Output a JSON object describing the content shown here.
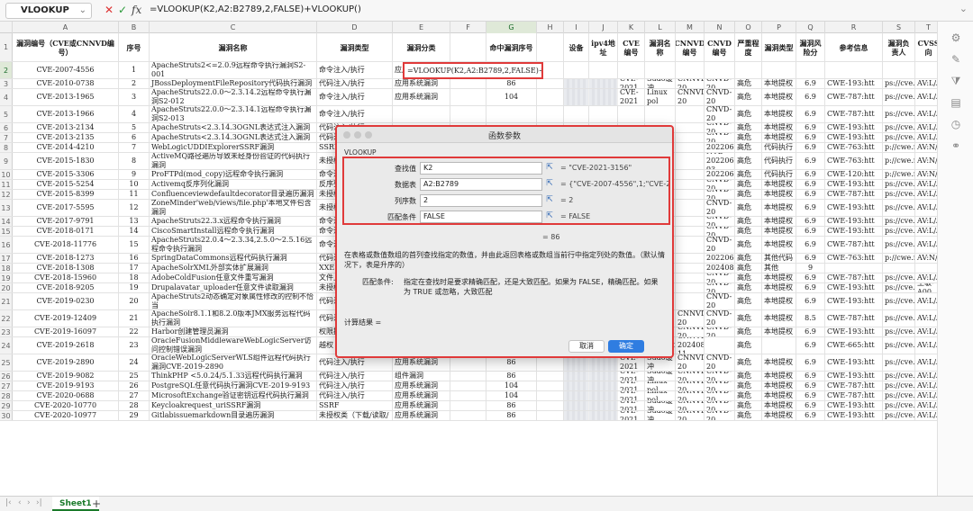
{
  "formula_bar": {
    "name_box": "VLOOKUP",
    "formula": "=VLOOKUP(K2,A2:B2789,2,FALSE)+VLOOKUP()"
  },
  "columns": [
    "A",
    "B",
    "C",
    "D",
    "E",
    "F",
    "G",
    "H",
    "I",
    "J",
    "K",
    "L",
    "M",
    "N",
    "O",
    "P",
    "Q",
    "R",
    "S",
    "T"
  ],
  "header_row": {
    "A": "漏洞编号（CVE或CNNVD编号）",
    "B": "序号",
    "C": "漏洞名称",
    "D": "漏洞类型",
    "E": "漏洞分类",
    "G": "命中漏洞序号",
    "I": "设备",
    "J": "ipv4地址",
    "K": "CVE编号",
    "L": "漏洞名称",
    "M": "CNNVD编号",
    "N": "CNVD编号",
    "O": "严重程度",
    "P": "漏洞类型",
    "Q": "漏洞风险分",
    "R": "参考信息",
    "S": "漏洞负责人",
    "T": "CVSS向"
  },
  "selected_cell": {
    "text": "=VLOOKUP(K2,A2:B2789,2,FALSE)+VLOOKUP("
  },
  "rows": [
    {
      "n": "2",
      "a": "CVE-2007-4556",
      "b": "1",
      "c": "ApacheStruts2<=2.0.9远程命令执行漏洞S2-001",
      "d": "命令注入/执行",
      "e": "应用系",
      "k": "",
      "l": "",
      "m": "",
      "n_": "",
      "o": "",
      "p": "",
      "q": "",
      "r": "",
      "s": "",
      "t": ""
    },
    {
      "n": "3",
      "a": "CVE-2010-0738",
      "b": "2",
      "c": "JBossDeploymentFileRepository代码执行漏洞",
      "d": "代码注入/执行",
      "e": "应用系统漏洞",
      "g": "86",
      "k": "CVE-2021",
      "l": "Sudo缓冲",
      "m": "CNNVD-20",
      "n_": "CNVD-20",
      "o": "高危",
      "p": "本地提权",
      "q": "6.9",
      "r": "CWE-193:htt",
      "s": "ps://cve.mitre.or",
      "t": "AV:L/A"
    },
    {
      "n": "4",
      "a": "CVE-2013-1965",
      "b": "3",
      "c": "ApacheStruts22.0.0～2.3.14.2远程命令执行漏洞S2-012",
      "d": "命令注入/执行",
      "e": "应用系统漏洞",
      "g": "104",
      "k": "CVE-2021",
      "l": "Linux pol",
      "m": "CNNVD-20",
      "n_": "CNVD-20",
      "o": "高危",
      "p": "本地提权",
      "q": "6.9",
      "r": "CWE-787:htt",
      "s": "ps://cve.mitre.or",
      "t": "AV:L/A"
    },
    {
      "n": "5",
      "a": "CVE-2013-1966",
      "b": "4",
      "c": "ApacheStruts22.0.0～2.3.14.1远程命令执行漏洞S2-013",
      "d": "命令注入/执行",
      "e": "",
      "g": "",
      "k": "",
      "l": "",
      "m": "",
      "n_": "CNVD-20",
      "o": "高危",
      "p": "本地提权",
      "q": "6.9",
      "r": "CWE-787:htt",
      "s": "ps://cve.mitre.or",
      "t": "AV:L/A"
    },
    {
      "n": "6",
      "a": "CVE-2013-2134",
      "b": "5",
      "c": "ApacheStruts<2.3.14.3OGNL表达式注入漏洞",
      "d": "代码注入/执行",
      "e": "",
      "g": "",
      "k": "",
      "l": "",
      "m": "",
      "n_": "CNVD-20",
      "o": "高危",
      "p": "本地提权",
      "q": "6.9",
      "r": "CWE-193:htt",
      "s": "ps://cve.mitre.or",
      "t": "AV:L/A"
    },
    {
      "n": "7",
      "a": "CVE-2013-2135",
      "b": "6",
      "c": "ApacheStruts<2.3.14.3OGNL表达式注入漏洞",
      "d": "代码注入/执行",
      "e": "",
      "g": "",
      "k": "",
      "l": "",
      "m": "",
      "n_": "CNVD-20",
      "o": "高危",
      "p": "本地提权",
      "q": "6.9",
      "r": "CWE-193:htt",
      "s": "ps://cve.mitre.or",
      "t": "AV:L/A"
    },
    {
      "n": "8",
      "a": "CVE-2014-4210",
      "b": "7",
      "c": "WebLogicUDDIExplorerSSRF漏洞",
      "d": "SSRF",
      "e": "",
      "g": "",
      "k": "",
      "l": "",
      "m": "",
      "n_": "NVD-202206-93",
      "o": "高危",
      "p": "代码执行",
      "q": "6.9",
      "r": "CWE-763:htt",
      "s": "p://cwe.mitre.org",
      "t": "AV:N/A"
    },
    {
      "n": "9",
      "a": "CVE-2015-1830",
      "b": "8",
      "c": "ActiveMQ路径遍历导致未经身份验证的代码执行漏洞",
      "d": "未授权类（",
      "e": "",
      "g": "",
      "k": "",
      "l": "",
      "m": "",
      "n_": "NVD-202206-93",
      "o": "高危",
      "p": "代码执行",
      "q": "6.9",
      "r": "CWE-763:htt",
      "s": "p://cwe.mitre.org",
      "t": "AV:N/A"
    },
    {
      "n": "10",
      "a": "CVE-2015-3306",
      "b": "9",
      "c": "ProFTPd(mod_copy)远程命令执行漏洞",
      "d": "命令注入/执行",
      "e": "",
      "g": "",
      "k": "",
      "l": "",
      "m": "",
      "n_": "NVD-202206-92",
      "o": "高危",
      "p": "代码执行",
      "q": "6.9",
      "r": "CWE-120:htt",
      "s": "p://cwe.mitre.org",
      "t": "AV:N/A"
    },
    {
      "n": "11",
      "a": "CVE-2015-5254",
      "b": "10",
      "c": "Activemq反序列化漏洞",
      "d": "反序列化",
      "e": "",
      "g": "",
      "k": "",
      "l": "",
      "m": "",
      "n_": "CNVD-20",
      "o": "高危",
      "p": "本地提权",
      "q": "6.9",
      "r": "CWE-193:htt",
      "s": "ps://cve.mitre.or",
      "t": "AV:L/A"
    },
    {
      "n": "12",
      "a": "CVE-2015-8399",
      "b": "11",
      "c": "Confluenceviewdefaultdecorator目录遍历漏洞",
      "d": "未授权类（",
      "e": "",
      "g": "",
      "k": "",
      "l": "",
      "m": "",
      "n_": "CNVD-20",
      "o": "高危",
      "p": "本地提权",
      "q": "6.9",
      "r": "CWE-787:htt",
      "s": "ps://cve.mitre.or",
      "t": "AV:L/A"
    },
    {
      "n": "13",
      "a": "CVE-2017-5595",
      "b": "12",
      "c": "ZoneMinder'web/views/file.php'本地文件包含漏洞",
      "d": "未授权类（",
      "e": "",
      "g": "86",
      "k": "",
      "l": "",
      "m": "",
      "n_": "CNVD-20",
      "o": "高危",
      "p": "本地提权",
      "q": "6.9",
      "r": "CWE-193:htt",
      "s": "ps://cve.mitre.or",
      "t": "AV:L/A"
    },
    {
      "n": "14",
      "a": "CVE-2017-9791",
      "b": "13",
      "c": "ApacheStruts22.3.x远程命令执行漏洞",
      "d": "命令注入/执行",
      "e": "",
      "g": "",
      "k": "",
      "l": "",
      "m": "",
      "n_": "CNVD-20",
      "o": "高危",
      "p": "本地提权",
      "q": "6.9",
      "r": "CWE-193:htt",
      "s": "ps://cve.mitre.or",
      "t": "AV:L/A"
    },
    {
      "n": "15",
      "a": "CVE-2018-0171",
      "b": "14",
      "c": "CiscoSmartInstall远程命令执行漏洞",
      "d": "命令注入/执行",
      "e": "",
      "g": "",
      "k": "",
      "l": "",
      "m": "",
      "n_": "CNVD-20",
      "o": "高危",
      "p": "本地提权",
      "q": "6.9",
      "r": "CWE-193:htt",
      "s": "ps://cve.mitre.or",
      "t": "AV:L/A"
    },
    {
      "n": "16",
      "a": "CVE-2018-11776",
      "b": "15",
      "c": "ApacheStruts22.0.4～2.3.34,2.5.0～2.5.16远程命令执行漏洞",
      "d": "命令注入/执行",
      "e": "",
      "g": "",
      "k": "",
      "l": "",
      "m": "",
      "n_": "CNVD-20",
      "o": "高危",
      "p": "本地提权",
      "q": "6.9",
      "r": "CWE-787:htt",
      "s": "ps://cve.mitre.or",
      "t": "AV:L/A"
    },
    {
      "n": "17",
      "a": "CVE-2018-1273",
      "b": "16",
      "c": "SpringDataCommons远程代码执行漏洞",
      "d": "代码注入/执行",
      "e": "",
      "g": "",
      "k": "",
      "l": "",
      "m": "",
      "n_": "NVD-202206-93",
      "o": "高危",
      "p": "其他代码",
      "q": "6.9",
      "r": "CWE-763:htt",
      "s": "p://cwe.mitre.org",
      "t": "AV:N/A"
    },
    {
      "n": "18",
      "a": "CVE-2018-1308",
      "b": "17",
      "c": "ApacheSolrXML外部实体扩展漏洞",
      "d": "XXE",
      "e": "",
      "g": "",
      "k": "",
      "l": "",
      "m": "",
      "n_": "CNVD-202408-1119",
      "o": "高危",
      "p": "其他",
      "q": "9",
      "r": "",
      "s": "",
      "t": ""
    },
    {
      "n": "19",
      "a": "CVE-2018-15960",
      "b": "18",
      "c": "AdobeColdFusion任意文件重写漏洞",
      "d": "文件上传",
      "e": "",
      "g": "",
      "k": "",
      "l": "",
      "m": "",
      "n_": "CNVD-20",
      "o": "高危",
      "p": "本地提权",
      "q": "6.9",
      "r": "CWE-787:htt",
      "s": "ps://cve.mitre.or",
      "t": "AV:L/A"
    },
    {
      "n": "20",
      "a": "CVE-2018-9205",
      "b": "19",
      "c": "Drupalavatar_uploader任意文件读取漏洞",
      "d": "未授权类（",
      "e": "",
      "g": "",
      "k": "",
      "l": "",
      "m": "",
      "n_": "CNVD-20",
      "o": "高危",
      "p": "本地提权",
      "q": "6.9",
      "r": "CWE-193:htt",
      "s": "ps://cve.mitre.or",
      "t": "王敏-A00"
    },
    {
      "n": "21",
      "a": "CVE-2019-0230",
      "b": "20",
      "c": "ApacheStruts2动态确定对象属性修改的控制不恰当",
      "d": "代码注入/执行",
      "e": "",
      "g": "",
      "k": "",
      "l": "",
      "m": "",
      "n_": "CNVD-20",
      "o": "高危",
      "p": "本地提权",
      "q": "6.9",
      "r": "CWE-193:htt",
      "s": "ps://cve.mitre.or",
      "t": "AV:L/A"
    },
    {
      "n": "22",
      "a": "CVE-2019-12409",
      "b": "21",
      "c": "ApacheSolr8.1.1和8.2.0版本JMX服务远程代码执行漏洞",
      "d": "代码注入/执行",
      "e": "应用系统漏洞",
      "g": "104",
      "k": "CVE-2021",
      "l": "Linux pol",
      "m": "CNNVD-20",
      "n_": "CNVD-20",
      "o": "高危",
      "p": "本地提权",
      "q": "8.5",
      "r": "CWE-787:htt",
      "s": "ps://cve.mitre.or",
      "t": "AV:L/A"
    },
    {
      "n": "23",
      "a": "CVE-2019-16097",
      "b": "22",
      "c": "Harbor创建管理员漏洞",
      "d": "权限提升",
      "e": "应用系统漏洞",
      "g": "86",
      "k": "CVE-2021",
      "l": "Sudo缓冲",
      "m": "CNNVD-20",
      "n_": "CNVD-20",
      "o": "高危",
      "p": "本地提权",
      "q": "6.9",
      "r": "CWE-193:htt",
      "s": "ps://cve.mitre.or",
      "t": "AV:L/A"
    },
    {
      "n": "24",
      "a": "CVE-2019-2618",
      "b": "23",
      "c": "OracleFusionMiddlewareWebLogicServer访问控制错误漏洞",
      "d": "越权（水平/垂直）",
      "e": "应用系统漏洞",
      "g": "#N/A",
      "k": "CVE-2022",
      "l": "Microsoft",
      "m": "CNNVD-202408-11",
      "n_": "",
      "o": "高危",
      "p": "",
      "q": "6.9",
      "r": "CWE-665:htt",
      "s": "ps://cve.mitre.or",
      "t": "AV:L/A"
    },
    {
      "n": "25",
      "a": "CVE-2019-2890",
      "b": "24",
      "c": "OracleWebLogicServerWLS组件远程代码执行漏洞CVE-2019-2890",
      "d": "代码注入/执行",
      "e": "应用系统漏洞",
      "g": "86",
      "k": "CVE-2021",
      "l": "Sudo缓冲",
      "m": "CNNVD-20",
      "n_": "CNVD-20",
      "o": "高危",
      "p": "本地提权",
      "q": "6.9",
      "r": "CWE-193:htt",
      "s": "ps://cve.mitre.or",
      "t": "AV:L/A"
    },
    {
      "n": "26",
      "a": "CVE-2019-9082",
      "b": "25",
      "c": "ThinkPHP <5.0.24/5.1.33远程代码执行漏洞",
      "d": "代码注入/执行",
      "e": "组件漏洞",
      "g": "86",
      "k": "CVE-2021",
      "l": "Sudo缓冲",
      "m": "CNNVD-20",
      "n_": "CNVD-20",
      "o": "高危",
      "p": "本地提权",
      "q": "6.9",
      "r": "CWE-193:htt",
      "s": "ps://cve.mitre.or",
      "t": "AV:L/A"
    },
    {
      "n": "27",
      "a": "CVE-2019-9193",
      "b": "26",
      "c": "PostgreSQL任意代码执行漏洞CVE-2019-9193",
      "d": "代码注入/执行",
      "e": "应用系统漏洞",
      "g": "104",
      "k": "CVE-2021",
      "l": "Linux pol",
      "m": "CNNVD-20",
      "n_": "CNVD-20",
      "o": "高危",
      "p": "本地提权",
      "q": "6.9",
      "r": "CWE-787:htt",
      "s": "ps://cve.mitre.or",
      "t": "AV:L/A"
    },
    {
      "n": "28",
      "a": "CVE-2020-0688",
      "b": "27",
      "c": "MicrosoftExchange验证密钥远程代码执行漏洞",
      "d": "代码注入/执行",
      "e": "应用系统漏洞",
      "g": "104",
      "k": "CVE-2021",
      "l": "Linux pol",
      "m": "CNNVD-20",
      "n_": "CNVD-20",
      "o": "高危",
      "p": "本地提权",
      "q": "6.9",
      "r": "CWE-787:htt",
      "s": "ps://cve.mitre.or",
      "t": "AV:L/A"
    },
    {
      "n": "29",
      "a": "CVE-2020-10770",
      "b": "28",
      "c": "Keycloakrequest_uriSSRF漏洞",
      "d": "SSRF",
      "e": "应用系统漏洞",
      "g": "86",
      "k": "CVE-2021",
      "l": "Sudo缓冲",
      "m": "CNNVD-20",
      "n_": "CNVD-20",
      "o": "高危",
      "p": "本地提权",
      "q": "6.9",
      "r": "CWE-193:htt",
      "s": "ps://cve.mitre.or",
      "t": "AV:L/A"
    },
    {
      "n": "30",
      "a": "CVE-2020-10977",
      "b": "29",
      "c": "Gitlabissuemarkdown目录遍历漏洞",
      "d": "未授权类（下载/读取/",
      "e": "应用系统漏洞",
      "g": "86",
      "k": "CVE-2021",
      "l": "Sudo缓冲",
      "m": "CNNVD-20",
      "n_": "CNVD-20",
      "o": "高危",
      "p": "本地提权",
      "q": "6.9",
      "r": "CWE-193:htt",
      "s": "ps://cve.mitre.or",
      "t": "AV:L/A"
    }
  ],
  "dialog": {
    "title": "函数参数",
    "function_name": "VLOOKUP",
    "args": [
      {
        "label": "查找值",
        "value": "K2",
        "result": "= \"CVE-2021-3156\""
      },
      {
        "label": "数据表",
        "value": "A2:B2789",
        "result": "= {\"CVE-2007-4556\",1;\"CVE-2010-0..."
      },
      {
        "label": "列序数",
        "value": "2",
        "result": "= 2"
      },
      {
        "label": "匹配条件",
        "value": "FALSE",
        "result": "= FALSE"
      }
    ],
    "peek_result": "= 86",
    "description": "在表格或数值数组的首列查找指定的数值，并由此返回表格或数组当前行中指定列处的数值。（默认情况下，表是升序的）",
    "arg_desc_label": "匹配条件:",
    "arg_desc_text": "指定在查找时是要求精确匹配，还是大致匹配。如果为 FALSE，精确匹配。如果为 TRUE 或忽略，大致匹配",
    "calc_result_label": "计算结果 =",
    "cancel_label": "取消",
    "ok_label": "确定"
  },
  "sheet_tabs": {
    "active": "Sheet1",
    "add": "+"
  },
  "icons": {
    "cancel": "✕",
    "confirm": "✓",
    "fx": "fx"
  }
}
